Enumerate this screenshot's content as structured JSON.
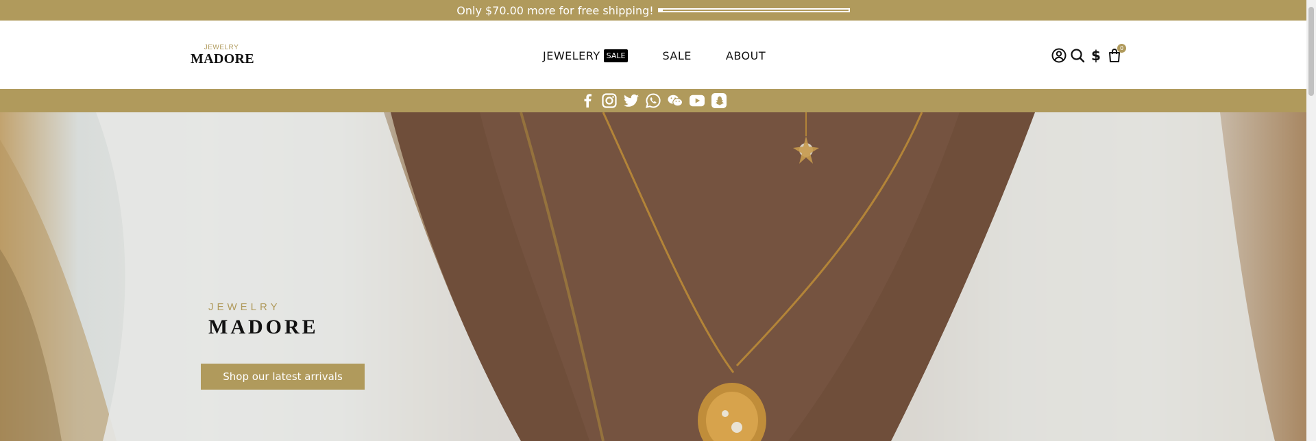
{
  "announcement": {
    "text": "Only $70.00 more for free shipping!",
    "progress": 0.02
  },
  "header": {
    "logo": {
      "small": "JEWELRY",
      "big": "MADORE"
    },
    "nav": [
      {
        "label": "JEWELERY",
        "badge": "SALE"
      },
      {
        "label": "SALE"
      },
      {
        "label": "ABOUT"
      }
    ],
    "icons": [
      "account-icon",
      "search-icon",
      "currency-icon",
      "cart-icon"
    ],
    "currency_symbol": "$",
    "cart_count": "0"
  },
  "social_icons": [
    "facebook-icon",
    "instagram-icon",
    "twitter-icon",
    "whatsapp-icon",
    "wechat-icon",
    "youtube-icon",
    "snapchat-icon"
  ],
  "hero": {
    "small": "JEWELRY",
    "big": "MADORE",
    "cta": "Shop our latest arrivals"
  },
  "colors": {
    "brand": "#b09a5c",
    "text": "#111111",
    "badge": "#000000"
  }
}
